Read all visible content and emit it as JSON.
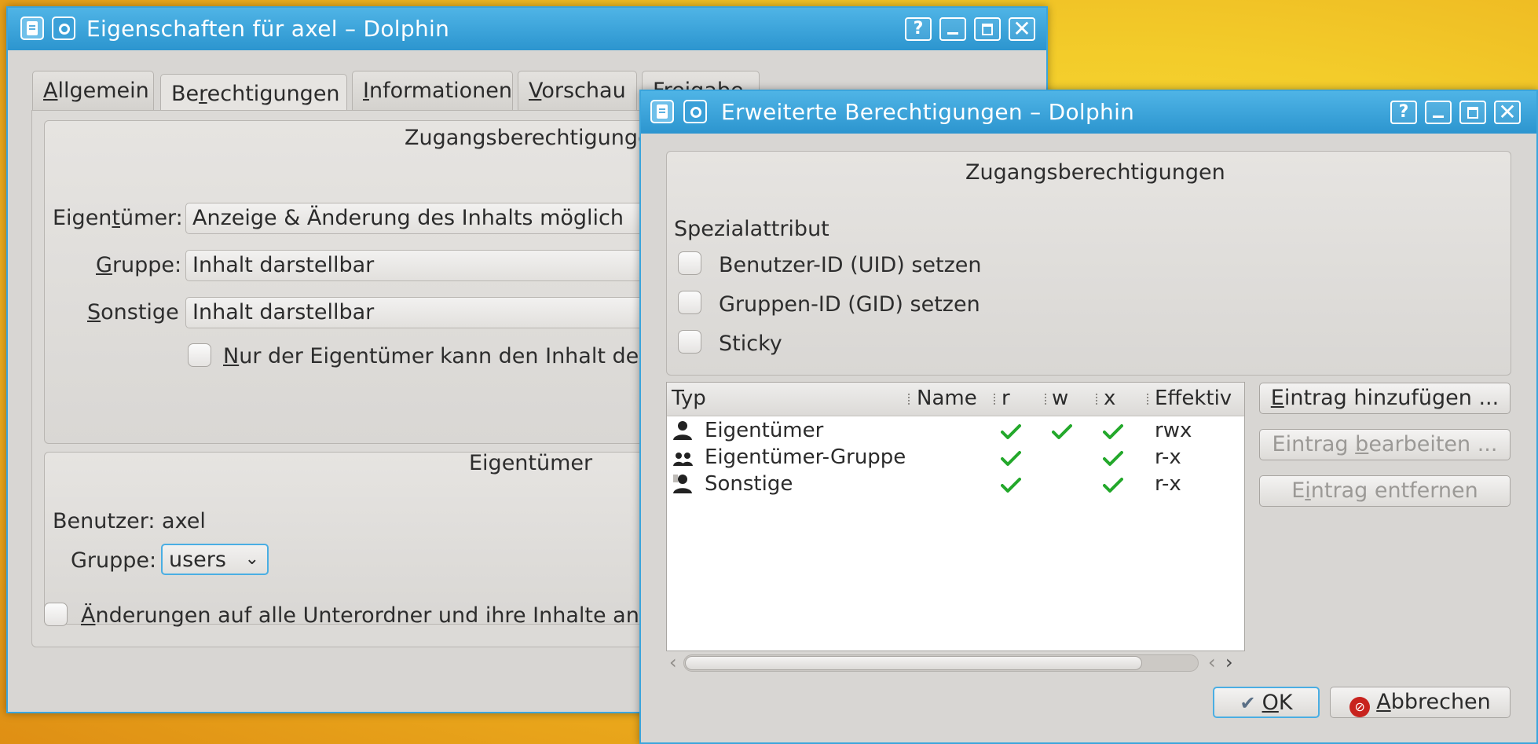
{
  "win1": {
    "title": "Eigenschaften für axel – Dolphin",
    "help_glyph": "?",
    "tabs": [
      {
        "pre": "",
        "u": "A",
        "post": "llgemein"
      },
      {
        "pre": "Be",
        "u": "r",
        "post": "echtigungen"
      },
      {
        "pre": "",
        "u": "I",
        "post": "nformationen"
      },
      {
        "pre": "",
        "u": "V",
        "post": "orschau"
      },
      {
        "pre": "",
        "u": "",
        "post": "Freigabe"
      }
    ],
    "access_group_title": "Zugangsberechtigungen",
    "owner_label": {
      "pre": "Eigen",
      "u": "t",
      "post": "ümer:"
    },
    "owner_value": "Anzeige & Änderung des Inhalts möglich",
    "group_label": {
      "pre": "",
      "u": "G",
      "post": "ruppe:"
    },
    "group_value": "Inhalt darstellbar",
    "others_label": {
      "pre": "",
      "u": "S",
      "post": "onstige"
    },
    "others_value": "Inhalt darstellbar",
    "only_owner_check": {
      "pre": "",
      "u": "N",
      "post": "ur der Eigentümer kann den Inhalt des Ordners umbenennen"
    },
    "ownership_group_title": "Eigentümer",
    "user_line": "Benutzer: axel",
    "group_select_label": "Gruppe:",
    "group_select_value": "users",
    "apply_recursive": {
      "pre": "",
      "u": "Ä",
      "post": "nderungen auf alle Unterordner und ihre Inhalte anwenden"
    }
  },
  "win2": {
    "title": "Erweiterte Berechtigungen – Dolphin",
    "help_glyph": "?",
    "group_title": "Zugangsberechtigungen",
    "special_label": "Spezialattribut",
    "special_checks": [
      "Benutzer-ID (UID) setzen",
      "Gruppen-ID (GID) setzen",
      "Sticky"
    ],
    "columns": [
      "Typ",
      "Name",
      "r",
      "w",
      "x",
      "Effektiv"
    ],
    "rows": [
      {
        "type": "Eigentümer",
        "icon": "user-icon",
        "r": true,
        "w": true,
        "x": true,
        "eff": "rwx"
      },
      {
        "type": "Eigentümer-Gruppe",
        "icon": "group-icon",
        "r": true,
        "w": false,
        "x": true,
        "eff": "r-x"
      },
      {
        "type": "Sonstige",
        "icon": "others-icon",
        "r": true,
        "w": false,
        "x": true,
        "eff": "r-x"
      }
    ],
    "add_entry": {
      "pre": "",
      "u": "E",
      "post": "intrag hinzufügen ..."
    },
    "edit_entry": {
      "pre": "Eintrag ",
      "u": "b",
      "post": "earbeiten ..."
    },
    "remove_entry": {
      "pre": "E",
      "u": "i",
      "post": "ntrag entfernen"
    },
    "ok": {
      "pre": "",
      "u": "O",
      "post": "K"
    },
    "cancel": {
      "pre": "",
      "u": "A",
      "post": "bbrechen"
    }
  },
  "colors": {
    "titlebar": "#3ba5dc",
    "check_green": "#23a82b",
    "cancel_red": "#c8231e"
  }
}
